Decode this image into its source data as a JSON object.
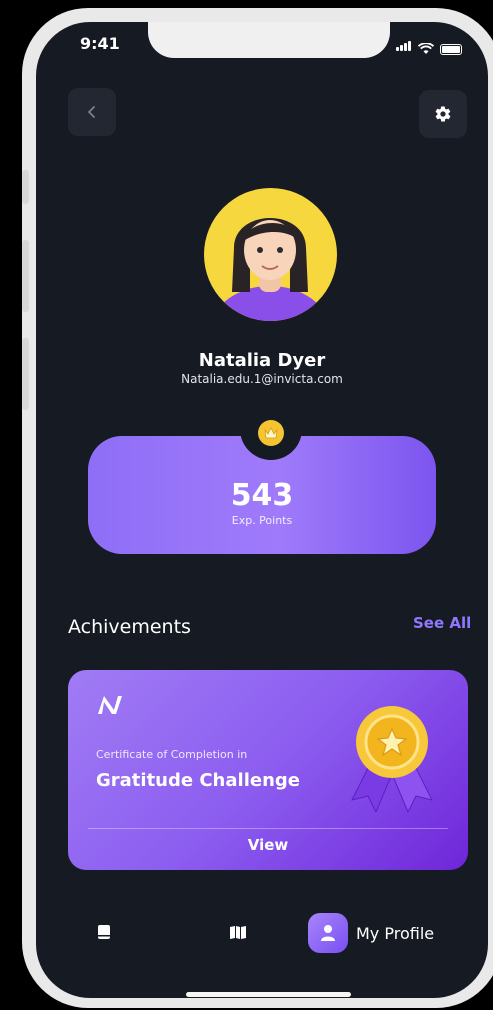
{
  "status_bar": {
    "time": "9:41"
  },
  "profile": {
    "name": "Natalia Dyer",
    "email": "Natalia.edu.1@invicta.com"
  },
  "points": {
    "value": "543",
    "label": "Exp. Points"
  },
  "achievements": {
    "title": "Achivements",
    "see_all": "See All",
    "card": {
      "subtitle": "Certificate of Completion in",
      "title": "Gratitude Challenge",
      "view": "View"
    }
  },
  "tab_bar": {
    "active_label": "My Profile"
  },
  "colors": {
    "background": "#161a23",
    "accent": "#8f78ff",
    "card_gradient_start": "#a07cf4",
    "card_gradient_end": "#6f26d9",
    "avatar_bg": "#f6d73d",
    "gold": "#f4c531"
  },
  "icons": {
    "back": "chevron-left-icon",
    "settings": "gear-icon",
    "crown": "crown-icon",
    "logo": "brand-logo-icon",
    "medal": "medal-icon",
    "tab_books": "book-icon",
    "tab_map": "map-icon",
    "tab_profile": "user-icon"
  }
}
